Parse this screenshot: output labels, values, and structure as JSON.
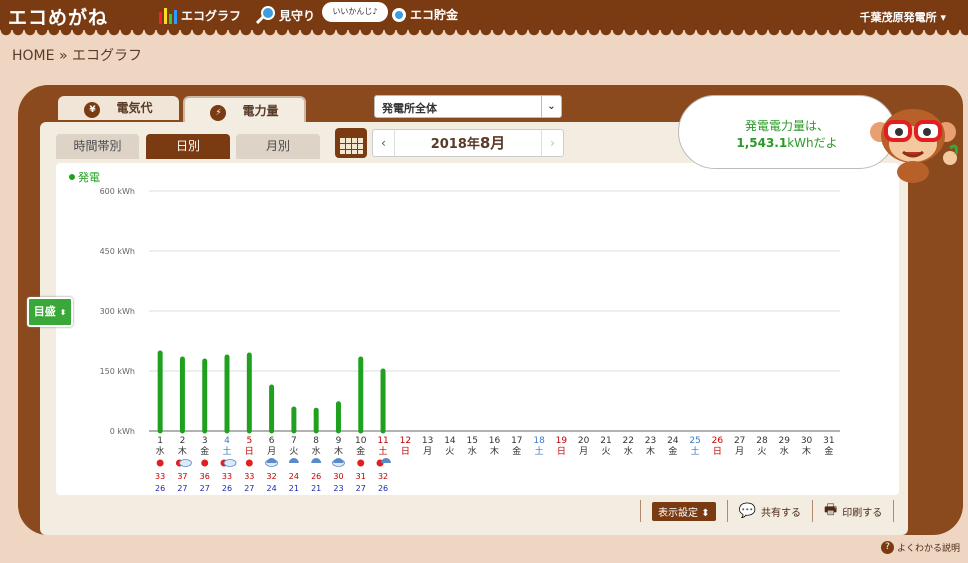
{
  "app": {
    "logo": "エコめがね",
    "nav": [
      {
        "label": "エコグラフ",
        "icon": "bar-chart-icon"
      },
      {
        "label": "見守り",
        "icon": "magnifier-icon"
      },
      {
        "label": "エコ貯金",
        "icon": "coin-icon"
      }
    ],
    "bubble": "いいかんじ♪",
    "plant": "千葉茂原発電所"
  },
  "breadcrumb": {
    "home": "HOME",
    "sep": "»",
    "current": "エコグラフ"
  },
  "tabs": [
    {
      "label": "電気代",
      "icon": "¥"
    },
    {
      "label": "電力量",
      "icon": "⚡"
    }
  ],
  "plant_select": {
    "value": "発電所全体"
  },
  "subtabs": [
    "時間帯別",
    "日別",
    "月別"
  ],
  "month": {
    "prefix": "2018年",
    "month": "8月",
    "prev": "‹",
    "next": "›"
  },
  "gauge_label": "目盛",
  "message": {
    "line1": "発電電力量は、",
    "amount": "1,543.1",
    "unit": "kWh",
    "suffix": "だよ"
  },
  "tools": {
    "display": "表示設定",
    "share": "共有する",
    "print": "印刷する"
  },
  "help": "よくわかる説明",
  "colors": {
    "header": "#7a3a12",
    "bar": "#1fa11f",
    "sat": "#3a78c8",
    "sun": "#c00000"
  },
  "chart_data": {
    "type": "bar",
    "legend": "発電",
    "ylim": [
      0,
      600
    ],
    "yticks": [
      0,
      150,
      300,
      450,
      600
    ],
    "ytick_labels": [
      "0 kWh",
      "150 kWh",
      "300 kWh",
      "450 kWh",
      "600 kWh"
    ],
    "days": [
      1,
      2,
      3,
      4,
      5,
      6,
      7,
      8,
      9,
      10,
      11,
      12,
      13,
      14,
      15,
      16,
      17,
      18,
      19,
      20,
      21,
      22,
      23,
      24,
      25,
      26,
      27,
      28,
      29,
      30,
      31
    ],
    "weekdays": [
      "水",
      "木",
      "金",
      "土",
      "日",
      "月",
      "火",
      "水",
      "木",
      "金",
      "土",
      "日",
      "月",
      "火",
      "水",
      "木",
      "金",
      "土",
      "日",
      "月",
      "火",
      "水",
      "木",
      "金",
      "土",
      "日",
      "月",
      "火",
      "水",
      "木",
      "金"
    ],
    "holidays": [
      11,
      12
    ],
    "values": [
      195,
      180,
      175,
      185,
      190,
      110,
      55,
      52,
      68,
      180,
      150
    ],
    "weather": [
      "sunny",
      "sunny-cloudy",
      "sunny",
      "sunny-cloudy",
      "sunny",
      "cloudy-rain",
      "rain",
      "rain",
      "cloudy-rain",
      "sunny",
      "sunny-rain"
    ],
    "high": [
      33,
      37,
      36,
      33,
      33,
      32,
      24,
      26,
      30,
      31,
      32
    ],
    "low": [
      26,
      27,
      27,
      26,
      27,
      24,
      21,
      21,
      23,
      27,
      26
    ]
  }
}
